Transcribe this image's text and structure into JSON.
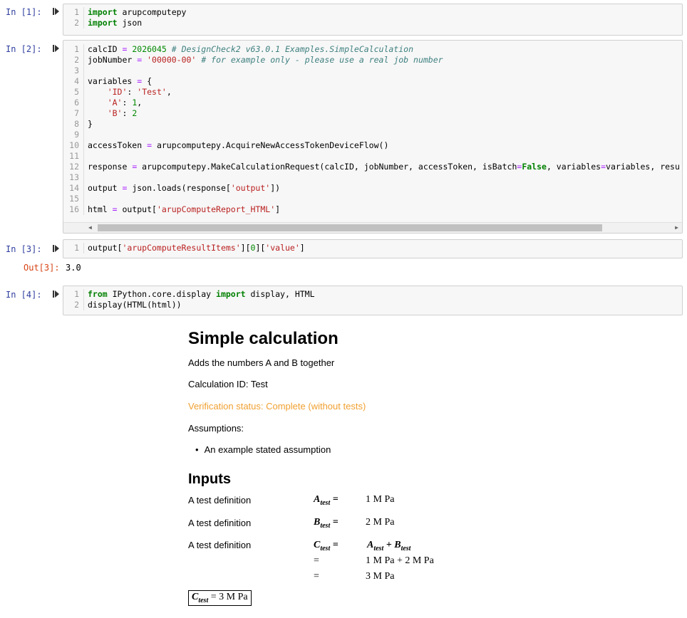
{
  "cells": [
    {
      "prompt": "In [1]:",
      "lines": [
        [
          [
            "kw",
            "import"
          ],
          [
            "t",
            " arupcomputepy"
          ]
        ],
        [
          [
            "kw",
            "import"
          ],
          [
            "t",
            " json"
          ]
        ]
      ]
    },
    {
      "prompt": "In [2]:",
      "lines": [
        [
          [
            "t",
            "calcID "
          ],
          [
            "op",
            "="
          ],
          [
            "t",
            " "
          ],
          [
            "num",
            "2026045"
          ],
          [
            "t",
            " "
          ],
          [
            "cm",
            "# DesignCheck2 v63.0.1 Examples.SimpleCalculation"
          ]
        ],
        [
          [
            "t",
            "jobNumber "
          ],
          [
            "op",
            "="
          ],
          [
            "t",
            " "
          ],
          [
            "str",
            "'00000-00'"
          ],
          [
            "t",
            " "
          ],
          [
            "cm",
            "# for example only - please use a real job number"
          ]
        ],
        [],
        [
          [
            "t",
            "variables "
          ],
          [
            "op",
            "="
          ],
          [
            "t",
            " {"
          ]
        ],
        [
          [
            "t",
            "    "
          ],
          [
            "str",
            "'ID'"
          ],
          [
            "t",
            ": "
          ],
          [
            "str",
            "'Test'"
          ],
          [
            "t",
            ","
          ]
        ],
        [
          [
            "t",
            "    "
          ],
          [
            "str",
            "'A'"
          ],
          [
            "t",
            ": "
          ],
          [
            "num",
            "1"
          ],
          [
            "t",
            ","
          ]
        ],
        [
          [
            "t",
            "    "
          ],
          [
            "str",
            "'B'"
          ],
          [
            "t",
            ": "
          ],
          [
            "num",
            "2"
          ]
        ],
        [
          [
            "t",
            "}"
          ]
        ],
        [],
        [
          [
            "t",
            "accessToken "
          ],
          [
            "op",
            "="
          ],
          [
            "t",
            " arupcomputepy.AcquireNewAccessTokenDeviceFlow()"
          ]
        ],
        [],
        [
          [
            "t",
            "response "
          ],
          [
            "op",
            "="
          ],
          [
            "t",
            " arupcomputepy.MakeCalculationRequest(calcID, jobNumber, accessToken, isBatch"
          ],
          [
            "op",
            "="
          ],
          [
            "kw",
            "False"
          ],
          [
            "t",
            ", variables"
          ],
          [
            "op",
            "="
          ],
          [
            "t",
            "variables, resu"
          ]
        ],
        [],
        [
          [
            "t",
            "output "
          ],
          [
            "op",
            "="
          ],
          [
            "t",
            " json.loads(response["
          ],
          [
            "str",
            "'output'"
          ],
          [
            "t",
            "])"
          ]
        ],
        [],
        [
          [
            "t",
            "html "
          ],
          [
            "op",
            "="
          ],
          [
            "t",
            " output["
          ],
          [
            "str",
            "'arupComputeReport_HTML'"
          ],
          [
            "t",
            "]"
          ]
        ]
      ]
    },
    {
      "prompt": "In [3]:",
      "lines": [
        [
          [
            "t",
            "output["
          ],
          [
            "str",
            "'arupComputeResultItems'"
          ],
          [
            "t",
            "]["
          ],
          [
            "num",
            "0"
          ],
          [
            "t",
            "]["
          ],
          [
            "str",
            "'value'"
          ],
          [
            "t",
            "]"
          ]
        ]
      ]
    },
    {
      "prompt": "In [4]:",
      "lines": [
        [
          [
            "kw",
            "from"
          ],
          [
            "t",
            " IPython.core.display "
          ],
          [
            "kw",
            "import"
          ],
          [
            "t",
            " display, HTML"
          ]
        ],
        [
          [
            "t",
            "display(HTML(html))"
          ]
        ]
      ]
    }
  ],
  "out3": {
    "prompt": "Out[3]:",
    "value": "3.0"
  },
  "report": {
    "title": "Simple calculation",
    "description": "Adds the numbers A and B together",
    "calc_id": "Calculation ID: Test",
    "verification": "Verification status: Complete (without tests)",
    "assumptions_label": "Assumptions:",
    "assumption_item": "An example stated assumption",
    "inputs_heading": "Inputs",
    "def1": "A test definition",
    "def2": "A test definition",
    "def3": "A test definition",
    "a_sym": "A",
    "a_sub": "test",
    "a_val": "1 M Pa",
    "b_sym": "B",
    "b_sub": "test",
    "b_val": "2 M Pa",
    "c_sym": "C",
    "c_sub": "test",
    "c_expr_sum": "A + B",
    "c_line2": "1 M Pa + 2 M Pa",
    "c_line3": "3 M Pa",
    "result_box": "= 3 M Pa",
    "verification_color": "#f0a030"
  }
}
